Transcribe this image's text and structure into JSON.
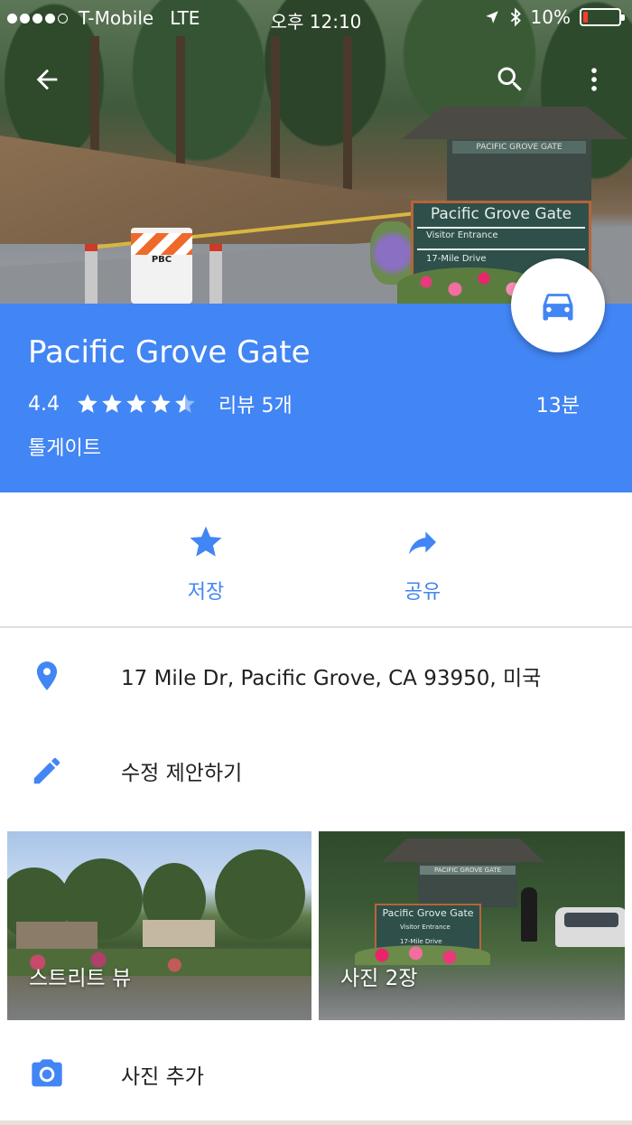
{
  "status_bar": {
    "carrier": "T-Mobile",
    "network": "LTE",
    "time": "오후 12:10",
    "battery": "10%"
  },
  "hero": {
    "booth_sign": "PACIFIC GROVE GATE",
    "sign_title": "Pacific Grove Gate",
    "sign_line1": "Visitor Entrance",
    "sign_line2": "17-Mile Drive",
    "barrier_text": "PBC"
  },
  "place": {
    "name": "Pacific Grove Gate",
    "rating": "4.4",
    "rating_value": 4.4,
    "reviews": "리뷰 5개",
    "drive_time": "13분",
    "category": "톨게이트"
  },
  "actions": {
    "save_label": "저장",
    "share_label": "공유"
  },
  "details": {
    "address": "17 Mile Dr, Pacific Grove, CA 93950, 미국",
    "suggest_edit": "수정 제안하기",
    "add_photo": "사진 추가"
  },
  "photos": {
    "street_view_label": "스트리트 뷰",
    "photos_label": "사진 2장",
    "photo2_sign_title": "Pacific Grove Gate",
    "photo2_sign_line1": "Visitor Entrance",
    "photo2_sign_line2": "17-Mile Drive",
    "photo2_booth": "PACIFIC GROVE GATE"
  },
  "colors": {
    "primary": "#4285f4",
    "header_text": "#ffffff",
    "body_text": "#212121"
  }
}
